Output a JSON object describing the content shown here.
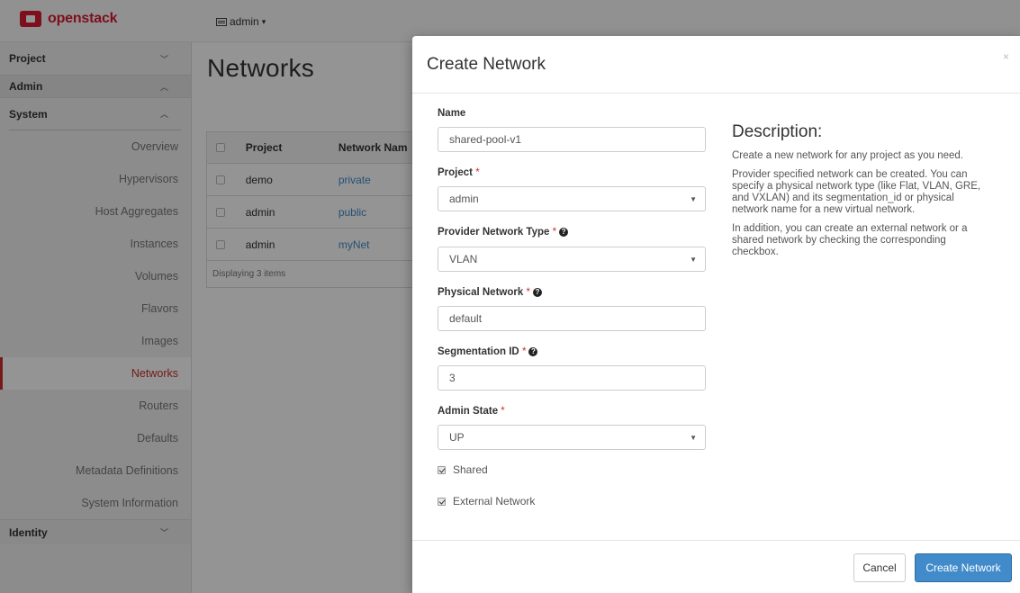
{
  "brand": {
    "name": "openstack"
  },
  "topbar": {
    "project_selector": "admin"
  },
  "sidebar": {
    "project_label": "Project",
    "admin_label": "Admin",
    "system_label": "System",
    "items": [
      {
        "label": "Overview"
      },
      {
        "label": "Hypervisors"
      },
      {
        "label": "Host Aggregates"
      },
      {
        "label": "Instances"
      },
      {
        "label": "Volumes"
      },
      {
        "label": "Flavors"
      },
      {
        "label": "Images"
      },
      {
        "label": "Networks"
      },
      {
        "label": "Routers"
      },
      {
        "label": "Defaults"
      },
      {
        "label": "Metadata Definitions"
      },
      {
        "label": "System Information"
      }
    ],
    "identity_label": "Identity"
  },
  "page": {
    "title": "Networks"
  },
  "table": {
    "headers": {
      "project": "Project",
      "network_name": "Network Nam"
    },
    "rows": [
      {
        "project": "demo",
        "network": "private"
      },
      {
        "project": "admin",
        "network": "public"
      },
      {
        "project": "admin",
        "network": "myNet"
      }
    ],
    "footer": "Displaying 3 items"
  },
  "modal": {
    "title": "Create Network",
    "close": "×",
    "fields": {
      "name_label": "Name",
      "name_value": "shared-pool-v1",
      "project_label": "Project",
      "project_value": "admin",
      "provider_type_label": "Provider Network Type",
      "provider_type_value": "VLAN",
      "physical_network_label": "Physical Network",
      "physical_network_value": "default",
      "segmentation_label": "Segmentation ID",
      "segmentation_value": "3",
      "admin_state_label": "Admin State",
      "admin_state_value": "UP",
      "shared_label": "Shared",
      "external_label": "External Network"
    },
    "description": {
      "title": "Description:",
      "p1": "Create a new network for any project as you need.",
      "p2": "Provider specified network can be created. You can specify a physical network type (like Flat, VLAN, GRE, and VXLAN) and its segmentation_id or physical network name for a new virtual network.",
      "p3": "In addition, you can create an external network or a shared network by checking the corresponding checkbox."
    },
    "buttons": {
      "cancel": "Cancel",
      "create": "Create Network"
    }
  },
  "required_marker": "*",
  "colors": {
    "brand_red": "#da1a32",
    "primary_blue": "#428bca",
    "active_red": "#c9302c"
  }
}
